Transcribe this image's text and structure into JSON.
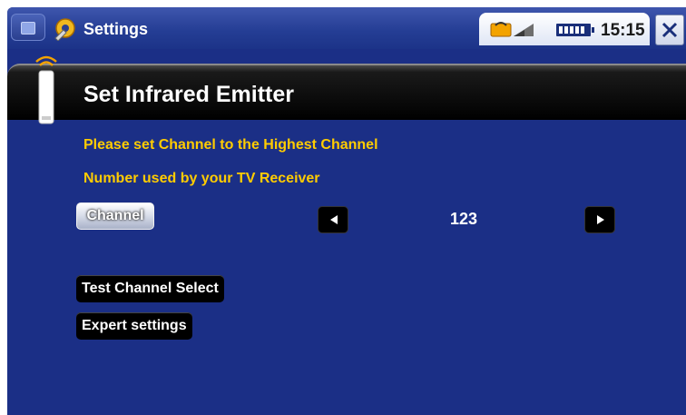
{
  "topbar": {
    "app_title": "Settings",
    "clock": "15:15"
  },
  "page": {
    "title": "Set Infrared Emitter",
    "instruction_line1": "Please set Channel to the Highest Channel",
    "instruction_line2": "Number used by your TV Receiver"
  },
  "channel": {
    "label": "Channel",
    "value": "123"
  },
  "actions": {
    "test_label": "Test Channel Select",
    "expert_label": "Expert settings"
  },
  "colors": {
    "background": "#1b2f86",
    "instruction_text": "#ffcc00",
    "header_band": "#000000"
  },
  "icons": {
    "menu": "menu-icon",
    "settings": "settings-icon",
    "link": "connection-icon",
    "battery": "battery-icon",
    "close": "close-icon",
    "remote": "remote-control-icon",
    "prev": "arrow-left-icon",
    "next": "arrow-right-icon"
  }
}
